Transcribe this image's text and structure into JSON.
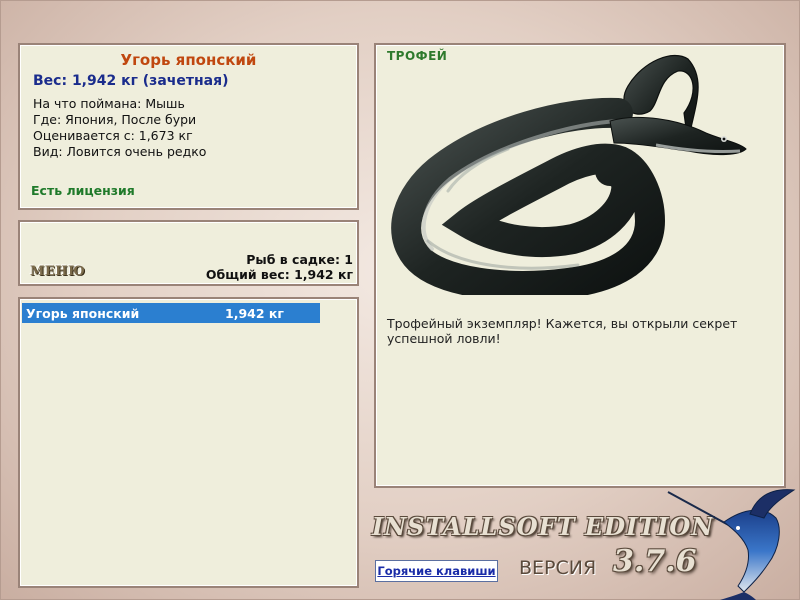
{
  "fish": {
    "name": "Угорь японский",
    "weight_line": "Вес: 1,942 кг (зачетная)",
    "bait": "На что поймана: Мышь",
    "place": "Где: Япония, После бури",
    "value": "Оценивается с: 1,673 кг",
    "rarity": "Вид: Ловится очень редко",
    "license": "Есть лицензия"
  },
  "menu": {
    "label": "МЕНЮ",
    "count_line": "Рыб в садке: 1",
    "total_line": "Общий вес: 1,942 кг"
  },
  "catch_list": [
    {
      "name": "Угорь японский",
      "weight": "1,942 кг"
    }
  ],
  "trophy": {
    "label": "ТРОФЕЙ",
    "message": "Трофейный экземпляр! Кажется, вы открыли секрет успешной ловли!"
  },
  "branding": {
    "edition": "INSTALLSOFT EDITION",
    "version_label": "ВЕРСИЯ",
    "version_number": "3.7.6",
    "hotkeys": "Горячие клавиши"
  },
  "colors": {
    "title": "#c0470f",
    "weight": "#1a2c8c",
    "license": "#1f7a2a",
    "selection": "#2b7fd0",
    "panel_bg": "#efeedc"
  },
  "icons": {
    "eel": "eel-image",
    "marlin": "marlin-logo"
  }
}
